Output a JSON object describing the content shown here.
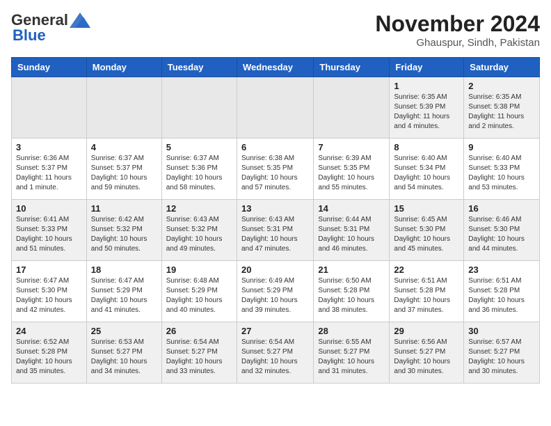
{
  "logo": {
    "general": "General",
    "blue": "Blue"
  },
  "header": {
    "month_year": "November 2024",
    "location": "Ghauspur, Sindh, Pakistan"
  },
  "weekdays": [
    "Sunday",
    "Monday",
    "Tuesday",
    "Wednesday",
    "Thursday",
    "Friday",
    "Saturday"
  ],
  "weeks": [
    {
      "days": [
        {
          "num": "",
          "info": ""
        },
        {
          "num": "",
          "info": ""
        },
        {
          "num": "",
          "info": ""
        },
        {
          "num": "",
          "info": ""
        },
        {
          "num": "",
          "info": ""
        },
        {
          "num": "1",
          "info": "Sunrise: 6:35 AM\nSunset: 5:39 PM\nDaylight: 11 hours\nand 4 minutes."
        },
        {
          "num": "2",
          "info": "Sunrise: 6:35 AM\nSunset: 5:38 PM\nDaylight: 11 hours\nand 2 minutes."
        }
      ]
    },
    {
      "days": [
        {
          "num": "3",
          "info": "Sunrise: 6:36 AM\nSunset: 5:37 PM\nDaylight: 11 hours\nand 1 minute."
        },
        {
          "num": "4",
          "info": "Sunrise: 6:37 AM\nSunset: 5:37 PM\nDaylight: 10 hours\nand 59 minutes."
        },
        {
          "num": "5",
          "info": "Sunrise: 6:37 AM\nSunset: 5:36 PM\nDaylight: 10 hours\nand 58 minutes."
        },
        {
          "num": "6",
          "info": "Sunrise: 6:38 AM\nSunset: 5:35 PM\nDaylight: 10 hours\nand 57 minutes."
        },
        {
          "num": "7",
          "info": "Sunrise: 6:39 AM\nSunset: 5:35 PM\nDaylight: 10 hours\nand 55 minutes."
        },
        {
          "num": "8",
          "info": "Sunrise: 6:40 AM\nSunset: 5:34 PM\nDaylight: 10 hours\nand 54 minutes."
        },
        {
          "num": "9",
          "info": "Sunrise: 6:40 AM\nSunset: 5:33 PM\nDaylight: 10 hours\nand 53 minutes."
        }
      ]
    },
    {
      "days": [
        {
          "num": "10",
          "info": "Sunrise: 6:41 AM\nSunset: 5:33 PM\nDaylight: 10 hours\nand 51 minutes."
        },
        {
          "num": "11",
          "info": "Sunrise: 6:42 AM\nSunset: 5:32 PM\nDaylight: 10 hours\nand 50 minutes."
        },
        {
          "num": "12",
          "info": "Sunrise: 6:43 AM\nSunset: 5:32 PM\nDaylight: 10 hours\nand 49 minutes."
        },
        {
          "num": "13",
          "info": "Sunrise: 6:43 AM\nSunset: 5:31 PM\nDaylight: 10 hours\nand 47 minutes."
        },
        {
          "num": "14",
          "info": "Sunrise: 6:44 AM\nSunset: 5:31 PM\nDaylight: 10 hours\nand 46 minutes."
        },
        {
          "num": "15",
          "info": "Sunrise: 6:45 AM\nSunset: 5:30 PM\nDaylight: 10 hours\nand 45 minutes."
        },
        {
          "num": "16",
          "info": "Sunrise: 6:46 AM\nSunset: 5:30 PM\nDaylight: 10 hours\nand 44 minutes."
        }
      ]
    },
    {
      "days": [
        {
          "num": "17",
          "info": "Sunrise: 6:47 AM\nSunset: 5:30 PM\nDaylight: 10 hours\nand 42 minutes."
        },
        {
          "num": "18",
          "info": "Sunrise: 6:47 AM\nSunset: 5:29 PM\nDaylight: 10 hours\nand 41 minutes."
        },
        {
          "num": "19",
          "info": "Sunrise: 6:48 AM\nSunset: 5:29 PM\nDaylight: 10 hours\nand 40 minutes."
        },
        {
          "num": "20",
          "info": "Sunrise: 6:49 AM\nSunset: 5:29 PM\nDaylight: 10 hours\nand 39 minutes."
        },
        {
          "num": "21",
          "info": "Sunrise: 6:50 AM\nSunset: 5:28 PM\nDaylight: 10 hours\nand 38 minutes."
        },
        {
          "num": "22",
          "info": "Sunrise: 6:51 AM\nSunset: 5:28 PM\nDaylight: 10 hours\nand 37 minutes."
        },
        {
          "num": "23",
          "info": "Sunrise: 6:51 AM\nSunset: 5:28 PM\nDaylight: 10 hours\nand 36 minutes."
        }
      ]
    },
    {
      "days": [
        {
          "num": "24",
          "info": "Sunrise: 6:52 AM\nSunset: 5:28 PM\nDaylight: 10 hours\nand 35 minutes."
        },
        {
          "num": "25",
          "info": "Sunrise: 6:53 AM\nSunset: 5:27 PM\nDaylight: 10 hours\nand 34 minutes."
        },
        {
          "num": "26",
          "info": "Sunrise: 6:54 AM\nSunset: 5:27 PM\nDaylight: 10 hours\nand 33 minutes."
        },
        {
          "num": "27",
          "info": "Sunrise: 6:54 AM\nSunset: 5:27 PM\nDaylight: 10 hours\nand 32 minutes."
        },
        {
          "num": "28",
          "info": "Sunrise: 6:55 AM\nSunset: 5:27 PM\nDaylight: 10 hours\nand 31 minutes."
        },
        {
          "num": "29",
          "info": "Sunrise: 6:56 AM\nSunset: 5:27 PM\nDaylight: 10 hours\nand 30 minutes."
        },
        {
          "num": "30",
          "info": "Sunrise: 6:57 AM\nSunset: 5:27 PM\nDaylight: 10 hours\nand 30 minutes."
        }
      ]
    }
  ]
}
